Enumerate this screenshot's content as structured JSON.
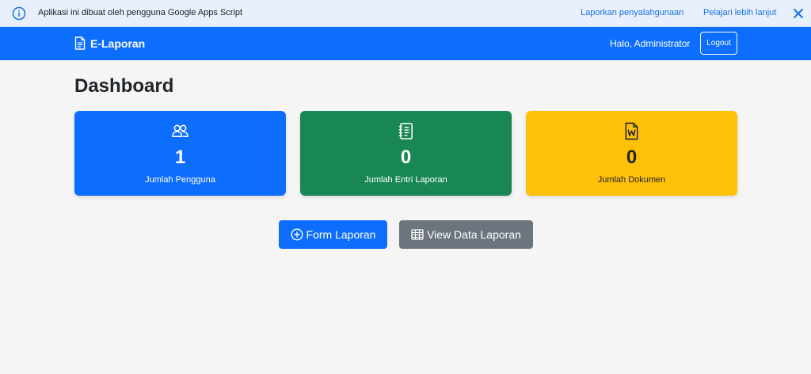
{
  "banner": {
    "message": "Aplikasi ini dibuat oleh pengguna Google Apps Script",
    "report_link": "Laporkan penyalahgunaan",
    "learn_link": "Pelajari lebih lanjut"
  },
  "navbar": {
    "brand": "E-Laporan",
    "greeting": "Halo, Administrator",
    "logout": "Logout"
  },
  "page": {
    "title": "Dashboard"
  },
  "cards": [
    {
      "icon": "people-icon",
      "count": "1",
      "label": "Jumlah Pengguna",
      "color": "#0d6efd"
    },
    {
      "icon": "journal-text-icon",
      "count": "0",
      "label": "Jumlah Entri Laporan",
      "color": "#198754"
    },
    {
      "icon": "word-document-icon",
      "count": "0",
      "label": "Jumlah Dokumen",
      "color": "#ffc107"
    }
  ],
  "actions": {
    "form_label": "Form Laporan",
    "view_label": "View Data Laporan"
  },
  "colors": {
    "primary": "#0d6efd",
    "success": "#198754",
    "warning": "#ffc107",
    "secondary": "#6c757d",
    "banner_bg": "#e8effd"
  }
}
